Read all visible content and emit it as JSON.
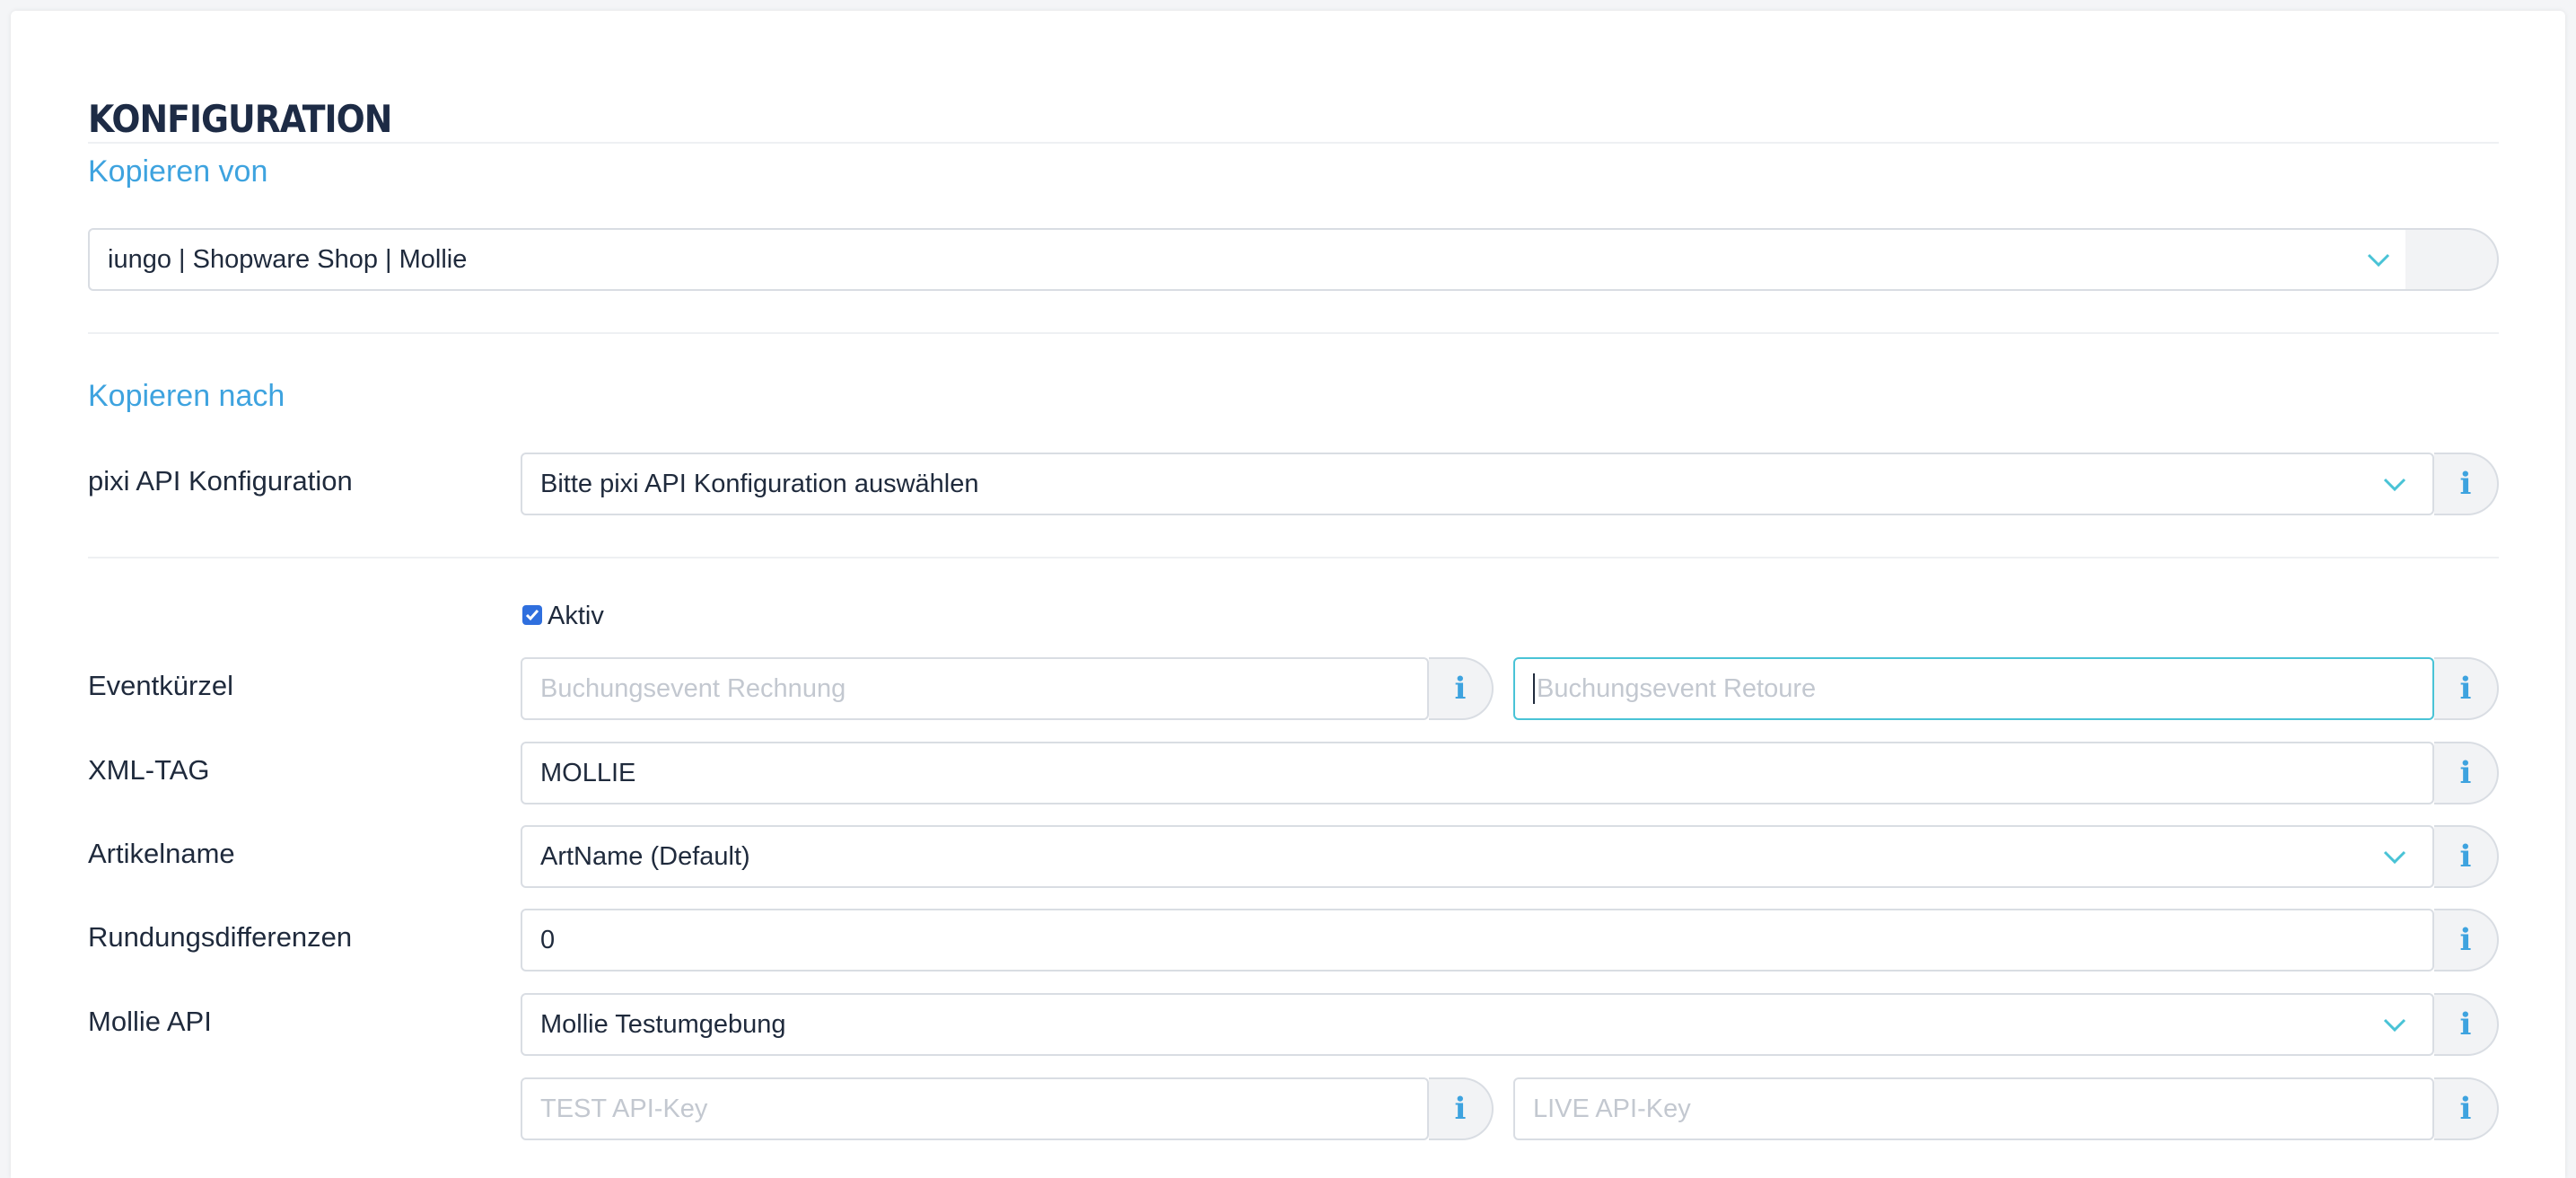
{
  "section_title": "KONFIGURATION",
  "copy_from": {
    "heading": "Kopieren von",
    "select_value": "iungo | Shopware Shop | Mollie"
  },
  "copy_to": {
    "heading": "Kopieren nach",
    "pixi_label": "pixi API Konfiguration",
    "pixi_value": "Bitte pixi API Konfiguration auswählen"
  },
  "active": {
    "label": "Aktiv",
    "checked": true
  },
  "eventkuerzel": {
    "label": "Eventkürzel",
    "invoice_placeholder": "Buchungsevent Rechnung",
    "return_placeholder": "Buchungsevent Retoure"
  },
  "xml_tag": {
    "label": "XML-TAG",
    "value": "MOLLIE"
  },
  "artikelname": {
    "label": "Artikelname",
    "value": "ArtName (Default)"
  },
  "rundung": {
    "label": "Rundungsdifferenzen",
    "value": "0"
  },
  "mollie_api": {
    "label": "Mollie API",
    "value": "Mollie Testumgebung",
    "test_placeholder": "TEST API-Key",
    "live_placeholder": "LIVE API-Key"
  },
  "icons": {
    "info": "i",
    "chevron": "chevron-down-icon",
    "check": "checkmark-icon"
  },
  "colors": {
    "accent": "#3ea3df",
    "heading": "#1d2b45",
    "focus": "#49c3d6",
    "checkbox": "#2f6fde"
  }
}
